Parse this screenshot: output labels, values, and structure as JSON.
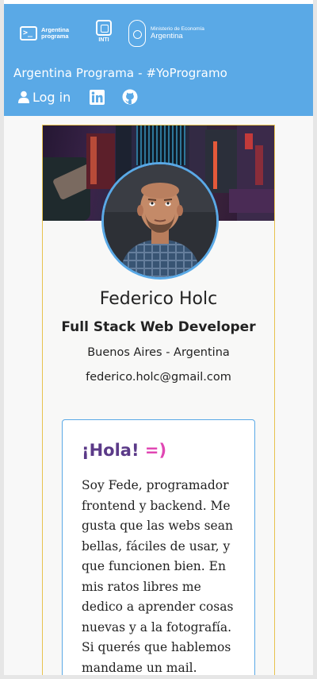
{
  "header": {
    "logos": {
      "argentina_programa": [
        "Argentina",
        "programa"
      ],
      "inti": "INTI",
      "ministerio": [
        "Ministerio de Economía",
        "Argentina"
      ],
      "terminal_glyph": ">_"
    },
    "site_title": "Argentina Programa - #YoProgramo",
    "login_label": "Log in",
    "social": [
      {
        "icon": "linkedin-icon"
      },
      {
        "icon": "github-icon"
      }
    ],
    "colors": {
      "bar": "#5aa9e6",
      "text": "#ffffff"
    }
  },
  "profile": {
    "name": "Federico Holc",
    "role": "Full Stack Web Developer",
    "location": "Buenos Aires - Argentina",
    "email": "federico.holc@gmail.com",
    "colors": {
      "card_border": "#e7c24e",
      "avatar_border": "#5aa9e6"
    }
  },
  "about": {
    "greeting": "¡Hola!",
    "smiley": "=)",
    "lines": [
      "Soy Fede, programador",
      "frontend y backend. Me",
      "gusta que las webs sean",
      "bellas, fáciles de usar, y",
      "que funcionen bien. En",
      "mis ratos libres me",
      "dedico a aprender cosas",
      "nuevas y a la fotografía.",
      "Si querés que hablemos",
      "mandame un mail."
    ],
    "colors": {
      "greeting": "#5b3a88",
      "smiley": "#e047b3"
    }
  }
}
